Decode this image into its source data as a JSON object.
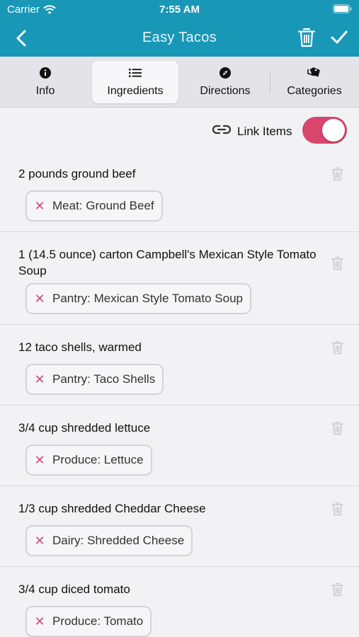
{
  "status": {
    "carrier": "Carrier",
    "time": "7:55 AM"
  },
  "nav": {
    "title": "Easy Tacos",
    "back_icon": "chevron-left-icon",
    "delete_icon": "trash-icon",
    "save_icon": "checkmark-icon"
  },
  "tabs": [
    {
      "label": "Info",
      "icon": "info-icon"
    },
    {
      "label": "Ingredients",
      "icon": "list-icon"
    },
    {
      "label": "Directions",
      "icon": "compass-icon"
    },
    {
      "label": "Categories",
      "icon": "tags-icon"
    }
  ],
  "active_tab": "Ingredients",
  "link_items": {
    "label": "Link Items",
    "enabled": true
  },
  "ingredients": [
    {
      "text": "2 pounds ground beef",
      "link": "Meat: Ground Beef"
    },
    {
      "text": "1 (14.5 ounce) carton Campbell's Mexican Style Tomato Soup",
      "link": "Pantry: Mexican Style Tomato Soup"
    },
    {
      "text": "12 taco shells, warmed",
      "link": "Pantry: Taco Shells"
    },
    {
      "text": "3/4 cup shredded lettuce",
      "link": "Produce: Lettuce"
    },
    {
      "text": "1/3 cup shredded Cheddar Cheese",
      "link": "Dairy: Shredded Cheese"
    },
    {
      "text": "3/4 cup diced tomato",
      "link": "Produce: Tomato"
    }
  ],
  "colors": {
    "header": "#1897b6",
    "accent": "#d8456d",
    "background": "#f2f2f5"
  }
}
